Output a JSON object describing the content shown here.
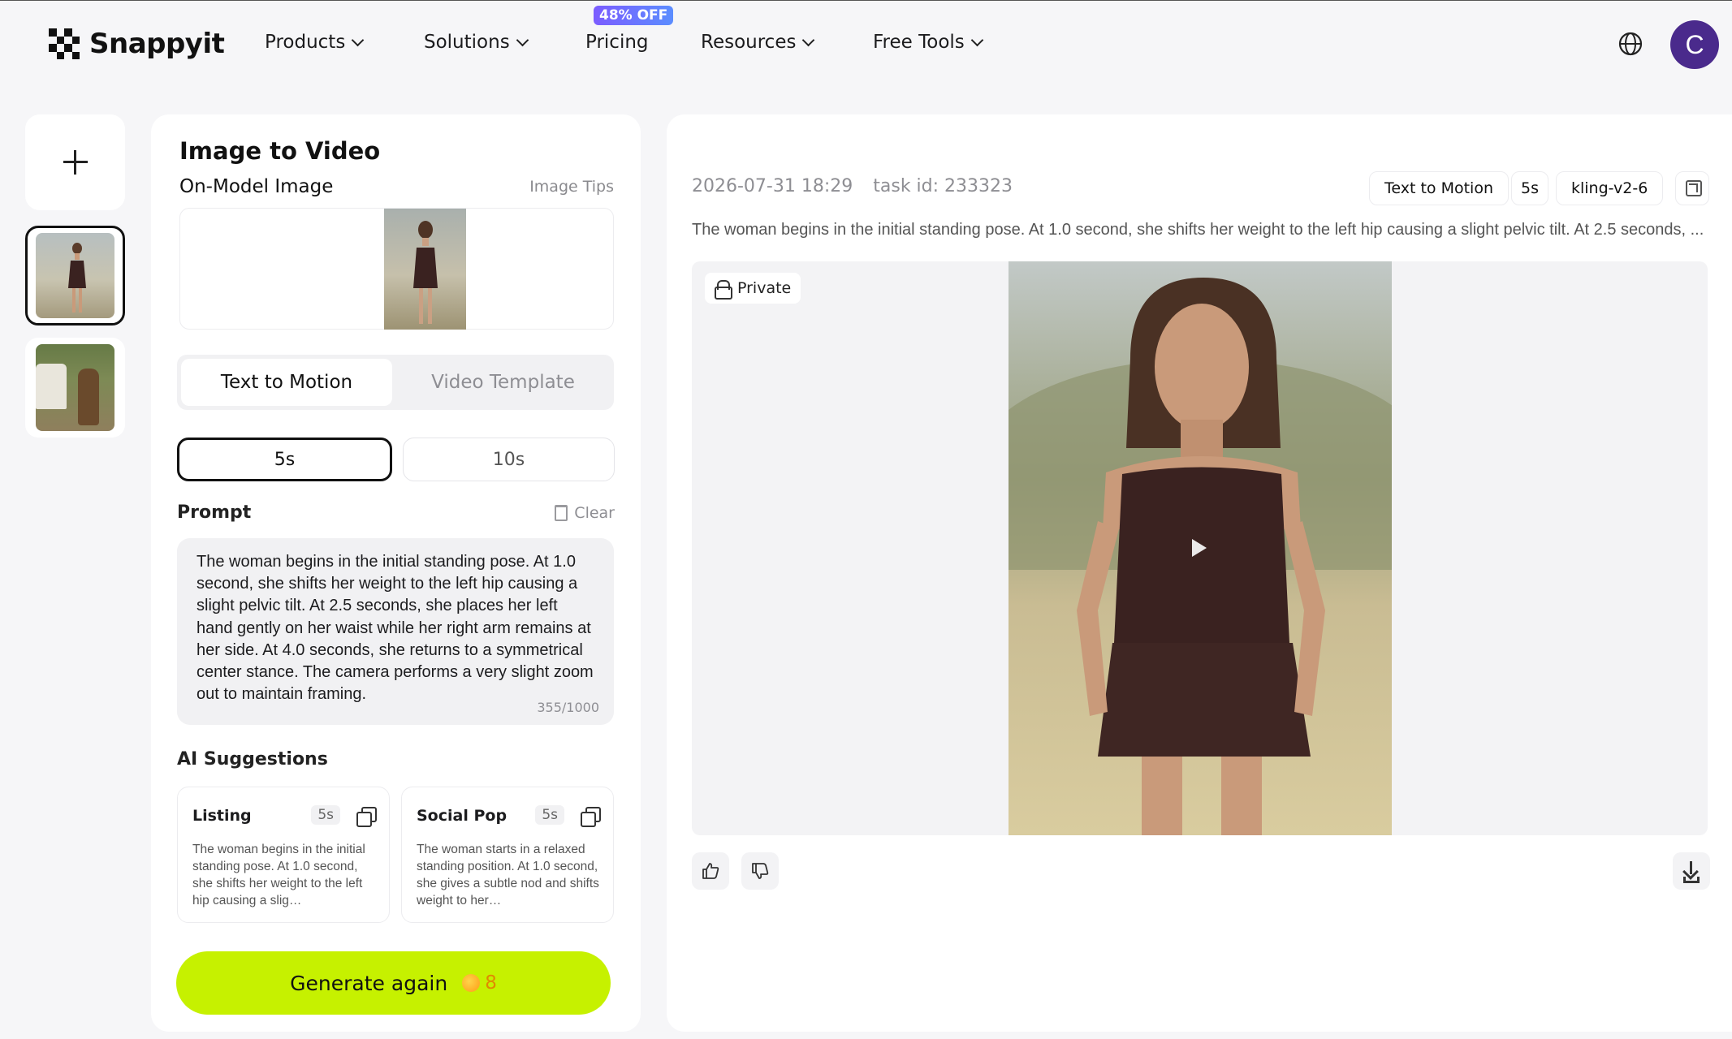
{
  "nav": {
    "brand": "Snappyit",
    "items": [
      {
        "label": "Products",
        "has_dropdown": true
      },
      {
        "label": "Solutions",
        "has_dropdown": true
      },
      {
        "label": "Pricing",
        "has_dropdown": false
      },
      {
        "label": "Resources",
        "has_dropdown": true
      },
      {
        "label": "Free Tools",
        "has_dropdown": true
      }
    ],
    "pricing_badge": "48% OFF",
    "globe_icon": "globe-icon",
    "avatar_initial": "C",
    "avatar_color": "#4a2a8c"
  },
  "rail": {
    "add_icon": "plus-icon",
    "thumbnails": [
      {
        "selected": true
      },
      {
        "selected": false
      }
    ]
  },
  "panel": {
    "title": "Image to Video",
    "image_label": "On-Model Image",
    "image_tips": "Image Tips",
    "tabs": [
      "Text to Motion",
      "Video Template"
    ],
    "active_tab": "Text to Motion",
    "durations": [
      "5s",
      "10s"
    ],
    "selected_duration": "5s",
    "prompt_label": "Prompt",
    "clear_label": "Clear",
    "prompt_text": "The woman begins in the initial standing pose. At 1.0 second, she shifts her weight to the left hip causing a slight pelvic tilt. At 2.5 seconds, she places her left hand gently on her waist while her right arm remains at her side. At 4.0 seconds, she returns to a symmetrical center stance. The camera performs a very slight zoom out to maintain framing.",
    "prompt_counter": "355/1000",
    "ai_label": "AI Suggestions",
    "suggestions": [
      {
        "title": "Listing",
        "duration": "5s",
        "text": "The woman begins in the initial standing pose. At 1.0 second, she shifts her weight to the left hip causing a slig…"
      },
      {
        "title": "Social Pop",
        "duration": "5s",
        "text": "The woman starts in a relaxed standing position. At 1.0 second, she gives a subtle nod and shifts weight to her…"
      }
    ],
    "generate_label": "Generate again",
    "credit_cost": "8",
    "accent_color": "#c6f100"
  },
  "result": {
    "timestamp": "2026-07-31 18:29",
    "task_id": "task id: 233323",
    "chips": [
      "Text to Motion",
      "5s",
      "kling-v2-6"
    ],
    "description": "The woman begins in the initial standing pose. At 1.0 second, she shifts her weight to the left hip causing a slight pelvic tilt. At 2.5 seconds, ...",
    "private_label": "Private",
    "icons": [
      "lock-icon",
      "play-icon",
      "thumbs-up-icon",
      "thumbs-down-icon",
      "download-icon",
      "reuse-icon"
    ]
  }
}
